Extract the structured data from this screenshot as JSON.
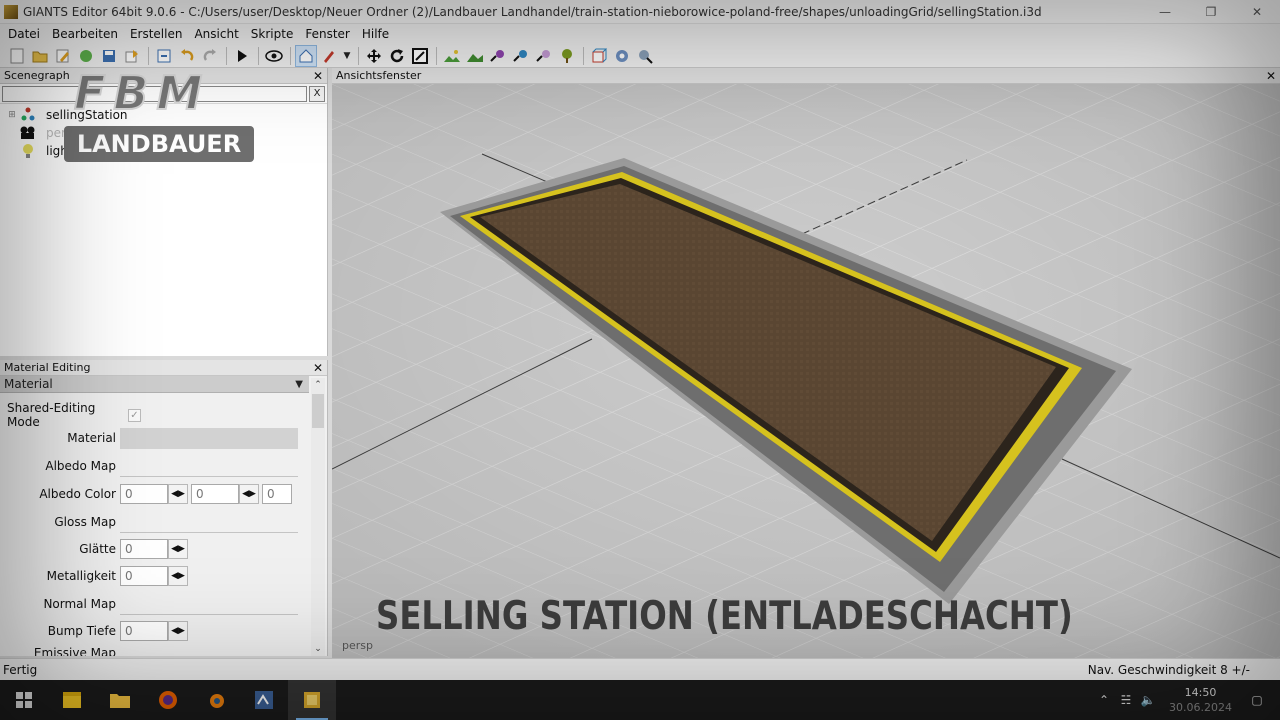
{
  "window": {
    "title": "GIANTS Editor 64bit 9.0.6 - C:/Users/user/Desktop/Neuer Ordner (2)/Landbauer Landhandel/train-station-nieborowice-poland-free/shapes/unloadingGrid/sellingStation.i3d"
  },
  "menu": [
    "Datei",
    "Bearbeiten",
    "Erstellen",
    "Ansicht",
    "Skripte",
    "Fenster",
    "Hilfe"
  ],
  "scenegraph": {
    "title": "Scenegraph",
    "filter_value": "",
    "clear_label": "X",
    "items": [
      {
        "label": "sellingStation",
        "icon": "transform-group-icon"
      },
      {
        "label": "persp",
        "icon": "camera-icon"
      },
      {
        "label": "light",
        "icon": "light-bulb-icon"
      }
    ]
  },
  "logo": {
    "top": "FBM",
    "bottom": "LANDBAUER"
  },
  "material_editing": {
    "title": "Material Editing",
    "section": "Material",
    "shared_editing_label": "Shared-Editing Mode",
    "material_label": "Material",
    "albedo_map_label": "Albedo Map",
    "albedo_color_label": "Albedo Color",
    "albedo_color": [
      "0",
      "0",
      "0"
    ],
    "gloss_map_label": "Gloss Map",
    "glaette_label": "Glätte",
    "glaette": "0",
    "metallic_label": "Metalligkeit",
    "metallic": "0",
    "normal_map_label": "Normal Map",
    "bump_label": "Bump Tiefe",
    "bump": "0",
    "emissive_label": "Emissive Map"
  },
  "viewport": {
    "title": "Ansichtsfenster",
    "camera_label": "persp",
    "caption": "SELLING STATION (ENTLADESCHACHT)"
  },
  "status": {
    "left": "Fertig",
    "right": "Nav. Geschwindigkeit 8 +/-"
  },
  "taskbar": {
    "time": "14:50",
    "date": "30.06.2024"
  },
  "colors": {
    "plate_brown": "#5a4632",
    "stripe_yellow": "#d6c21e",
    "accent_blue": "#7ab7f0"
  }
}
